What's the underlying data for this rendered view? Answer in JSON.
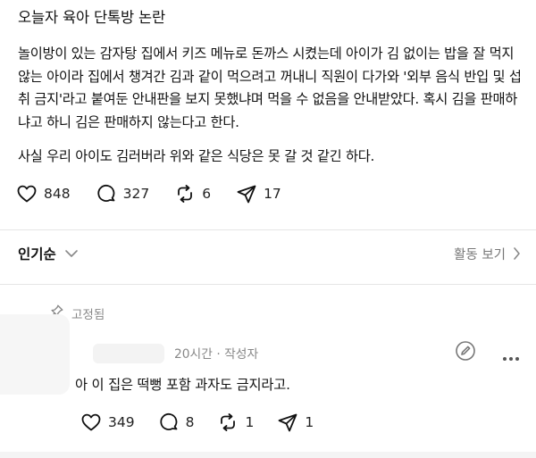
{
  "post": {
    "title": "오늘자 육아 단톡방 논란",
    "paragraphs": [
      "놀이방이 있는 감자탕 집에서 키즈 메뉴로 돈까스 시켰는데 아이가 김 없이는 밥을 잘 먹지 않는 아이라 집에서 챙겨간 김과 같이 먹으려고 꺼내니 직원이 다가와 '외부 음식 반입 및 섭취 금지'라고 붙여둔 안내판을 보지 못했냐며 먹을 수 없음을 안내받았다. 혹시 김을 판매하냐고 하니 김은 판매하지 않는다고 한다.",
      "사실 우리 아이도 김러버라 위와 같은 식당은 못 갈 것 같긴 하다."
    ],
    "stats": {
      "likes": "848",
      "comments": "327",
      "reposts": "6",
      "shares": "17"
    }
  },
  "sort": {
    "label": "인기순",
    "activity_label": "활동 보기"
  },
  "comment": {
    "pinned_label": "고정됨",
    "meta": "20시간 · 작성자",
    "text": "아 이 집은 떡뻥 포함 과자도 금지라고.",
    "stats": {
      "likes": "349",
      "comments": "8",
      "reposts": "1",
      "shares": "1"
    }
  },
  "icons": [
    "heart-icon",
    "comment-icon",
    "repost-icon",
    "send-icon",
    "chevron-down-icon",
    "chevron-right-icon",
    "pin-icon",
    "edit-icon",
    "more-icon"
  ]
}
